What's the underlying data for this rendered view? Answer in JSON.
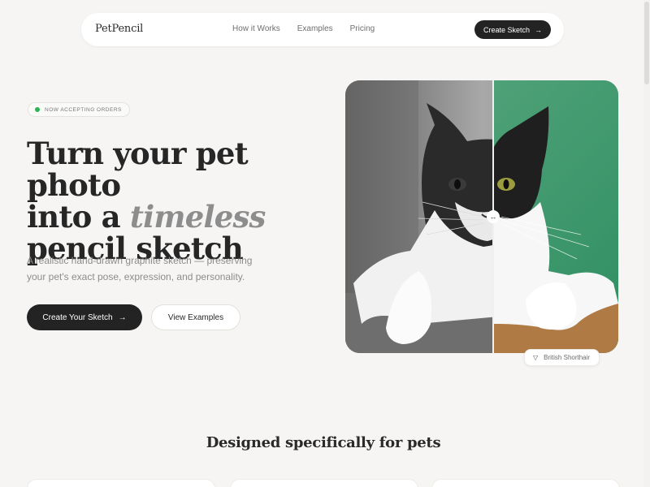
{
  "nav": {
    "brand": "PetPencil",
    "links": [
      "How it Works",
      "Examples",
      "Pricing"
    ],
    "cta_label": "Create Sketch",
    "cta_icon": "→"
  },
  "hero": {
    "badge": "NOW ACCEPTING ORDERS",
    "headline_line1": "Turn your pet photo",
    "headline_line2_prefix": "into a ",
    "headline_line2_em": "timeless",
    "headline_line3": "pencil sketch",
    "subtext": "A realistic hand-drawn graphite sketch — preserving your pet's exact pose, expression, and personality.",
    "primary_button": "Create Your Sketch",
    "primary_icon": "→",
    "secondary_button": "View Examples",
    "image_tag": "British Shorthair",
    "handle_icon": "↔"
  },
  "section": {
    "title": "Designed specifically for pets"
  },
  "colors": {
    "background": "#f6f5f3",
    "primary": "#232323",
    "accent_green": "#2ab552",
    "photo_green": "#3f9a6e"
  }
}
